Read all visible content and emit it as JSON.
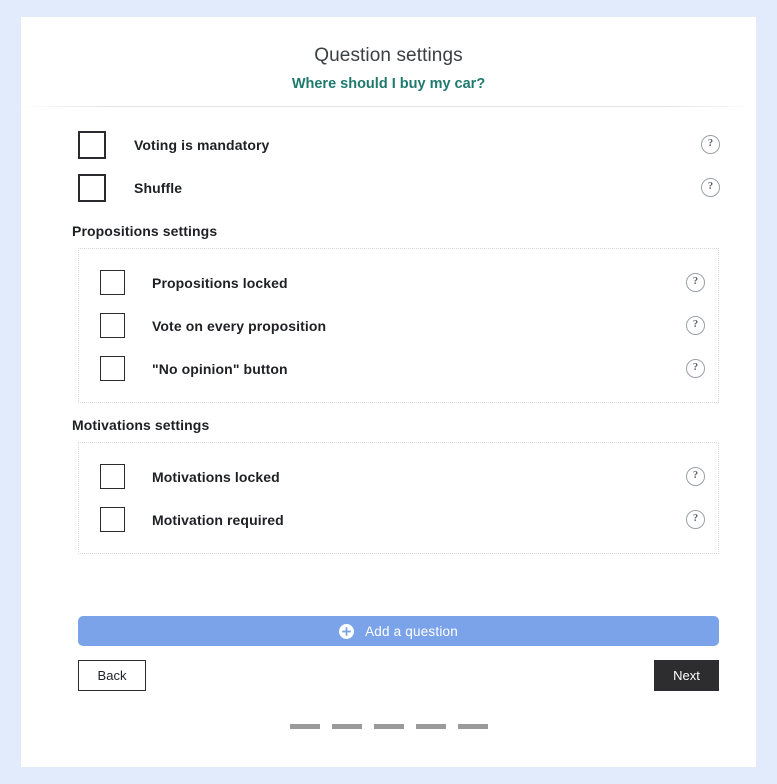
{
  "header": {
    "title": "Question settings",
    "subtitle": "Where should I buy my car?"
  },
  "top_options": [
    {
      "label": "Voting is mandatory",
      "checked": false,
      "help": "?"
    },
    {
      "label": "Shuffle",
      "checked": false,
      "help": "?"
    }
  ],
  "sections": [
    {
      "title": "Propositions settings",
      "options": [
        {
          "label": "Propositions locked",
          "checked": false,
          "help": "?"
        },
        {
          "label": "Vote on every proposition",
          "checked": false,
          "help": "?"
        },
        {
          "label": "\"No opinion\" button",
          "checked": false,
          "help": "?"
        }
      ]
    },
    {
      "title": "Motivations settings",
      "options": [
        {
          "label": "Motivations locked",
          "checked": false,
          "help": "?"
        },
        {
          "label": "Motivation required",
          "checked": false,
          "help": "?"
        }
      ]
    }
  ],
  "actions": {
    "add_question_label": "Add a question",
    "add_question_icon": "plus-circle-icon",
    "back_label": "Back",
    "next_label": "Next"
  },
  "steps": {
    "count": 5,
    "current": 0
  },
  "colors": {
    "page_background": "#e2ebfb",
    "card_background": "#ffffff",
    "subtitle": "#1f7a6e",
    "add_button": "#7ba3ea",
    "next_button": "#2d2d2f",
    "step": "#9a9a9a"
  }
}
